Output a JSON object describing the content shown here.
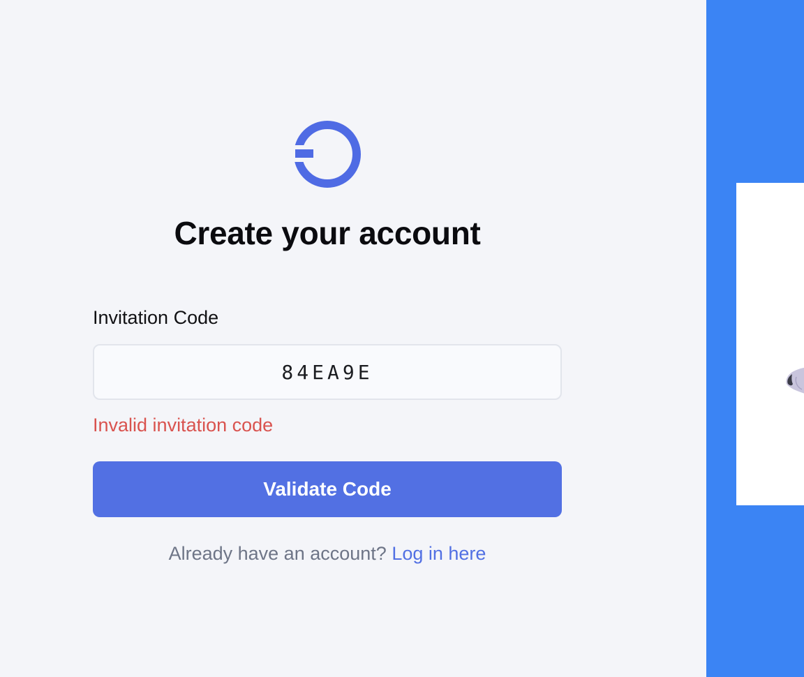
{
  "page": {
    "title": "Create your account"
  },
  "logo": {
    "icon": "circle-logo-icon",
    "color": "#4f6be4"
  },
  "form": {
    "field_label": "Invitation Code",
    "code_value": "84EA9E",
    "error_message": "Invalid invitation code",
    "submit_label": "Validate Code"
  },
  "footer": {
    "prompt": "Already have an account?",
    "login_link": "Log in here"
  },
  "colors": {
    "background": "#f4f5f9",
    "accent": "#5270e3",
    "error": "#d9534f",
    "side_panel": "#3b84f4"
  }
}
